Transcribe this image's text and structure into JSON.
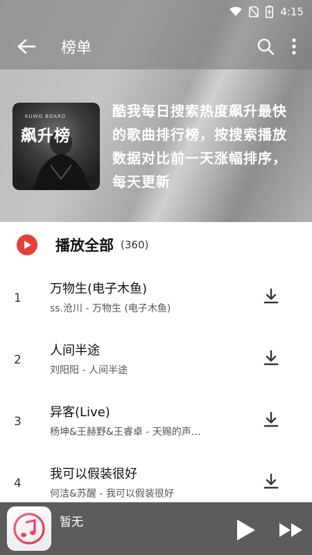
{
  "status_bar": {
    "time": "4:15"
  },
  "toolbar": {
    "title": "榜单"
  },
  "board": {
    "cover_small_text": "KUWO BOARD",
    "cover_title": "飙升榜",
    "description": "酷我每日搜索热度飙升最快的歌曲排行榜，按搜索播放数据对比前一天涨幅排序，每天更新"
  },
  "play_all": {
    "label": "播放全部",
    "count": "(360)"
  },
  "songs": [
    {
      "rank": "1",
      "title": "万物生(电子木鱼)",
      "subtitle": "ss.沧川 - 万物生 (电子木鱼)"
    },
    {
      "rank": "2",
      "title": "人间半途",
      "subtitle": "刘阳阳 - 人间半途"
    },
    {
      "rank": "3",
      "title": "异客(Live)",
      "subtitle": "杨坤&王赫野&王睿卓 - 天赐的声…"
    },
    {
      "rank": "4",
      "title": "我可以假装很好",
      "subtitle": "何洁&苏醒 - 我可以假装很好"
    }
  ],
  "mini_player": {
    "now_playing": "暂无"
  },
  "colors": {
    "accent_red": "#e84038",
    "player_bg": "#5c5c5c"
  },
  "icons": [
    "back-arrow-icon",
    "search-icon",
    "more-vertical-icon",
    "wifi-icon",
    "no-sim-icon",
    "battery-charging-icon",
    "play-icon",
    "download-icon",
    "music-note-icon",
    "skip-next-icon"
  ]
}
